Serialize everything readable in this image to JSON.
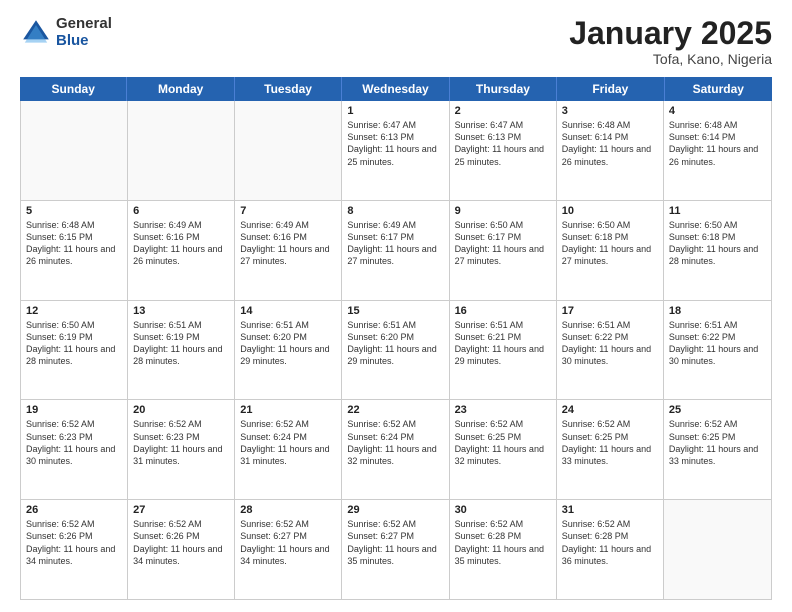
{
  "header": {
    "logo_general": "General",
    "logo_blue": "Blue",
    "month_title": "January 2025",
    "location": "Tofa, Kano, Nigeria"
  },
  "days_of_week": [
    "Sunday",
    "Monday",
    "Tuesday",
    "Wednesday",
    "Thursday",
    "Friday",
    "Saturday"
  ],
  "rows": [
    [
      {
        "day": "",
        "sunrise": "",
        "sunset": "",
        "daylight": ""
      },
      {
        "day": "",
        "sunrise": "",
        "sunset": "",
        "daylight": ""
      },
      {
        "day": "",
        "sunrise": "",
        "sunset": "",
        "daylight": ""
      },
      {
        "day": "1",
        "sunrise": "Sunrise: 6:47 AM",
        "sunset": "Sunset: 6:13 PM",
        "daylight": "Daylight: 11 hours and 25 minutes."
      },
      {
        "day": "2",
        "sunrise": "Sunrise: 6:47 AM",
        "sunset": "Sunset: 6:13 PM",
        "daylight": "Daylight: 11 hours and 25 minutes."
      },
      {
        "day": "3",
        "sunrise": "Sunrise: 6:48 AM",
        "sunset": "Sunset: 6:14 PM",
        "daylight": "Daylight: 11 hours and 26 minutes."
      },
      {
        "day": "4",
        "sunrise": "Sunrise: 6:48 AM",
        "sunset": "Sunset: 6:14 PM",
        "daylight": "Daylight: 11 hours and 26 minutes."
      }
    ],
    [
      {
        "day": "5",
        "sunrise": "Sunrise: 6:48 AM",
        "sunset": "Sunset: 6:15 PM",
        "daylight": "Daylight: 11 hours and 26 minutes."
      },
      {
        "day": "6",
        "sunrise": "Sunrise: 6:49 AM",
        "sunset": "Sunset: 6:16 PM",
        "daylight": "Daylight: 11 hours and 26 minutes."
      },
      {
        "day": "7",
        "sunrise": "Sunrise: 6:49 AM",
        "sunset": "Sunset: 6:16 PM",
        "daylight": "Daylight: 11 hours and 27 minutes."
      },
      {
        "day": "8",
        "sunrise": "Sunrise: 6:49 AM",
        "sunset": "Sunset: 6:17 PM",
        "daylight": "Daylight: 11 hours and 27 minutes."
      },
      {
        "day": "9",
        "sunrise": "Sunrise: 6:50 AM",
        "sunset": "Sunset: 6:17 PM",
        "daylight": "Daylight: 11 hours and 27 minutes."
      },
      {
        "day": "10",
        "sunrise": "Sunrise: 6:50 AM",
        "sunset": "Sunset: 6:18 PM",
        "daylight": "Daylight: 11 hours and 27 minutes."
      },
      {
        "day": "11",
        "sunrise": "Sunrise: 6:50 AM",
        "sunset": "Sunset: 6:18 PM",
        "daylight": "Daylight: 11 hours and 28 minutes."
      }
    ],
    [
      {
        "day": "12",
        "sunrise": "Sunrise: 6:50 AM",
        "sunset": "Sunset: 6:19 PM",
        "daylight": "Daylight: 11 hours and 28 minutes."
      },
      {
        "day": "13",
        "sunrise": "Sunrise: 6:51 AM",
        "sunset": "Sunset: 6:19 PM",
        "daylight": "Daylight: 11 hours and 28 minutes."
      },
      {
        "day": "14",
        "sunrise": "Sunrise: 6:51 AM",
        "sunset": "Sunset: 6:20 PM",
        "daylight": "Daylight: 11 hours and 29 minutes."
      },
      {
        "day": "15",
        "sunrise": "Sunrise: 6:51 AM",
        "sunset": "Sunset: 6:20 PM",
        "daylight": "Daylight: 11 hours and 29 minutes."
      },
      {
        "day": "16",
        "sunrise": "Sunrise: 6:51 AM",
        "sunset": "Sunset: 6:21 PM",
        "daylight": "Daylight: 11 hours and 29 minutes."
      },
      {
        "day": "17",
        "sunrise": "Sunrise: 6:51 AM",
        "sunset": "Sunset: 6:22 PM",
        "daylight": "Daylight: 11 hours and 30 minutes."
      },
      {
        "day": "18",
        "sunrise": "Sunrise: 6:51 AM",
        "sunset": "Sunset: 6:22 PM",
        "daylight": "Daylight: 11 hours and 30 minutes."
      }
    ],
    [
      {
        "day": "19",
        "sunrise": "Sunrise: 6:52 AM",
        "sunset": "Sunset: 6:23 PM",
        "daylight": "Daylight: 11 hours and 30 minutes."
      },
      {
        "day": "20",
        "sunrise": "Sunrise: 6:52 AM",
        "sunset": "Sunset: 6:23 PM",
        "daylight": "Daylight: 11 hours and 31 minutes."
      },
      {
        "day": "21",
        "sunrise": "Sunrise: 6:52 AM",
        "sunset": "Sunset: 6:24 PM",
        "daylight": "Daylight: 11 hours and 31 minutes."
      },
      {
        "day": "22",
        "sunrise": "Sunrise: 6:52 AM",
        "sunset": "Sunset: 6:24 PM",
        "daylight": "Daylight: 11 hours and 32 minutes."
      },
      {
        "day": "23",
        "sunrise": "Sunrise: 6:52 AM",
        "sunset": "Sunset: 6:25 PM",
        "daylight": "Daylight: 11 hours and 32 minutes."
      },
      {
        "day": "24",
        "sunrise": "Sunrise: 6:52 AM",
        "sunset": "Sunset: 6:25 PM",
        "daylight": "Daylight: 11 hours and 33 minutes."
      },
      {
        "day": "25",
        "sunrise": "Sunrise: 6:52 AM",
        "sunset": "Sunset: 6:25 PM",
        "daylight": "Daylight: 11 hours and 33 minutes."
      }
    ],
    [
      {
        "day": "26",
        "sunrise": "Sunrise: 6:52 AM",
        "sunset": "Sunset: 6:26 PM",
        "daylight": "Daylight: 11 hours and 34 minutes."
      },
      {
        "day": "27",
        "sunrise": "Sunrise: 6:52 AM",
        "sunset": "Sunset: 6:26 PM",
        "daylight": "Daylight: 11 hours and 34 minutes."
      },
      {
        "day": "28",
        "sunrise": "Sunrise: 6:52 AM",
        "sunset": "Sunset: 6:27 PM",
        "daylight": "Daylight: 11 hours and 34 minutes."
      },
      {
        "day": "29",
        "sunrise": "Sunrise: 6:52 AM",
        "sunset": "Sunset: 6:27 PM",
        "daylight": "Daylight: 11 hours and 35 minutes."
      },
      {
        "day": "30",
        "sunrise": "Sunrise: 6:52 AM",
        "sunset": "Sunset: 6:28 PM",
        "daylight": "Daylight: 11 hours and 35 minutes."
      },
      {
        "day": "31",
        "sunrise": "Sunrise: 6:52 AM",
        "sunset": "Sunset: 6:28 PM",
        "daylight": "Daylight: 11 hours and 36 minutes."
      },
      {
        "day": "",
        "sunrise": "",
        "sunset": "",
        "daylight": ""
      }
    ]
  ]
}
